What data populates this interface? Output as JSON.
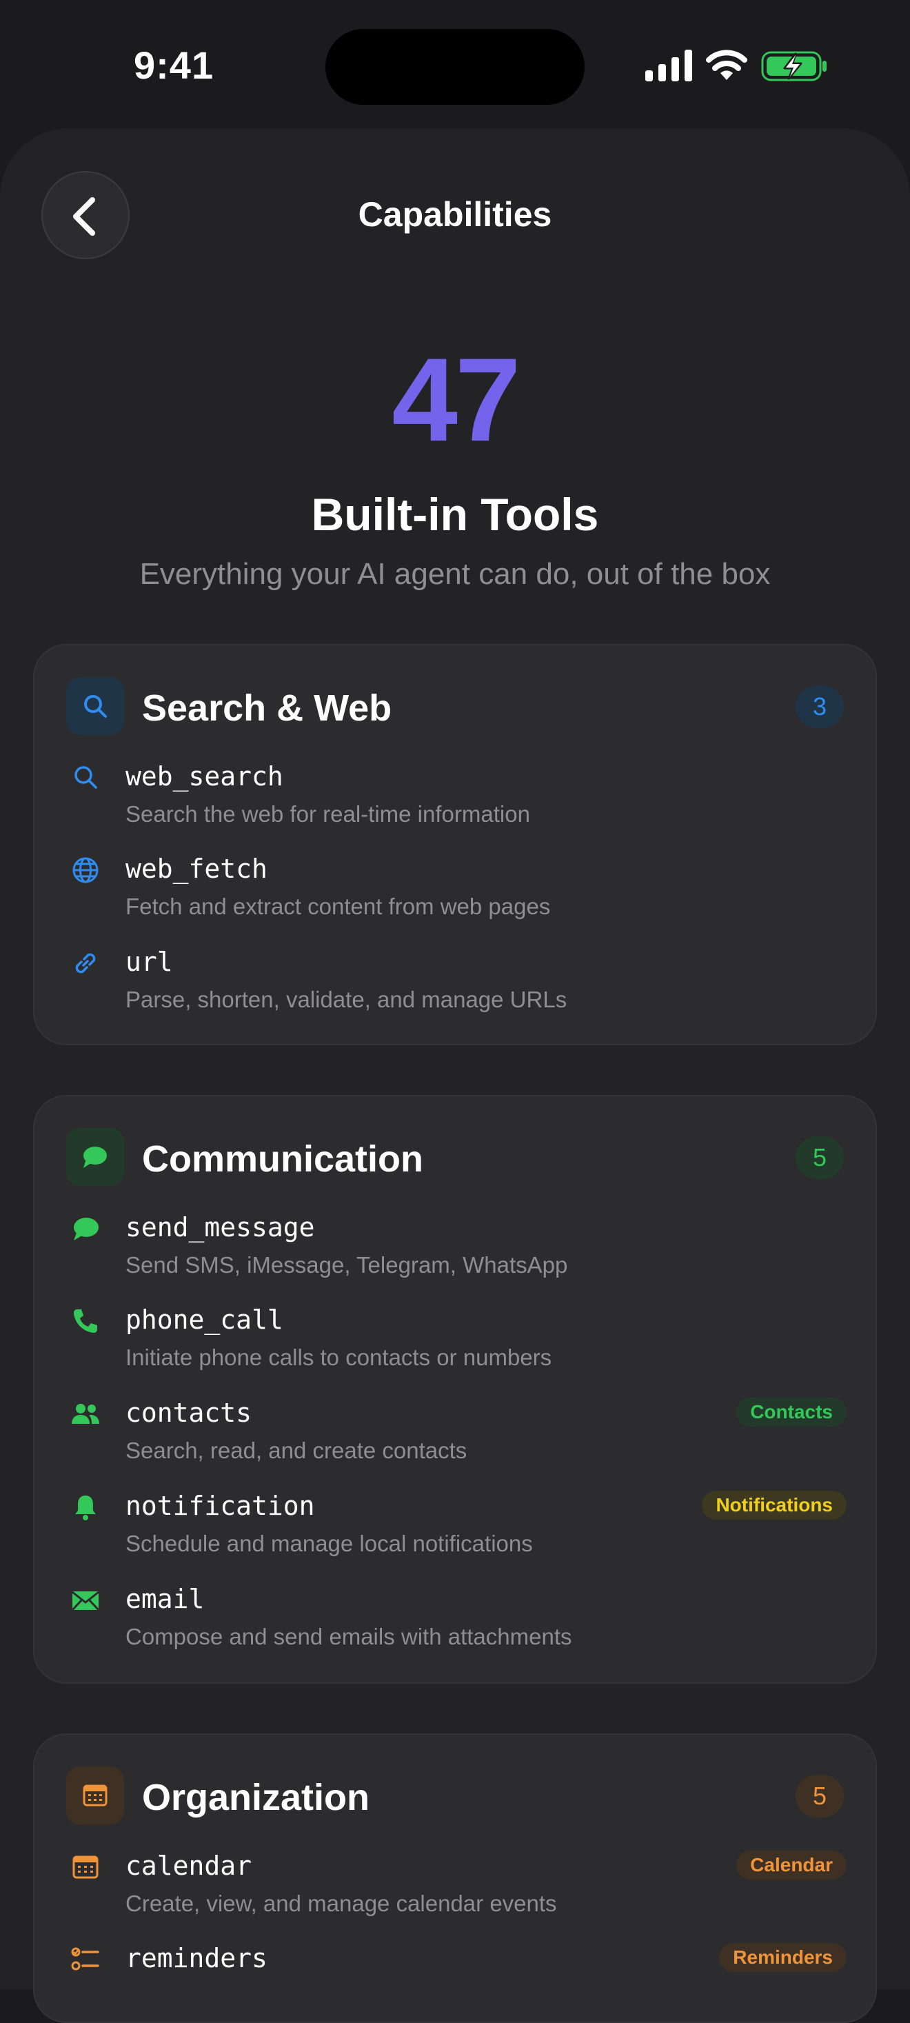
{
  "status": {
    "time": "9:41"
  },
  "header": {
    "title": "Capabilities"
  },
  "hero": {
    "count": "47",
    "title": "Built-in Tools",
    "subtitle": "Everything your AI agent can do, out of the box"
  },
  "colors": {
    "blue": "#2f8cf0",
    "green": "#34c759",
    "orange": "#f0943a",
    "yellow": "#f2cf1d",
    "purple": "#7464ec"
  },
  "sections": [
    {
      "title": "Search & Web",
      "count": "3",
      "icon": "magnifier-icon",
      "tools": [
        {
          "name": "web_search",
          "desc": "Search the web for real-time information",
          "icon": "search-icon"
        },
        {
          "name": "web_fetch",
          "desc": "Fetch and extract content from web pages",
          "icon": "globe-icon"
        },
        {
          "name": "url",
          "desc": "Parse, shorten, validate, and manage URLs",
          "icon": "link-icon"
        }
      ]
    },
    {
      "title": "Communication",
      "count": "5",
      "icon": "chat-bubble-icon",
      "tools": [
        {
          "name": "send_message",
          "desc": "Send SMS, iMessage, Telegram, WhatsApp",
          "icon": "message-icon"
        },
        {
          "name": "phone_call",
          "desc": "Initiate phone calls to contacts or numbers",
          "icon": "phone-icon"
        },
        {
          "name": "contacts",
          "desc": "Search, read, and create contacts",
          "icon": "people-icon",
          "badge": "Contacts"
        },
        {
          "name": "notification",
          "desc": "Schedule and manage local notifications",
          "icon": "bell-icon",
          "badge": "Notifications"
        },
        {
          "name": "email",
          "desc": "Compose and send emails with attachments",
          "icon": "envelope-icon"
        }
      ]
    },
    {
      "title": "Organization",
      "count": "5",
      "icon": "calendar-icon",
      "tools": [
        {
          "name": "calendar",
          "desc": "Create, view, and manage calendar events",
          "icon": "calendar-icon",
          "badge": "Calendar"
        },
        {
          "name": "reminders",
          "desc": "",
          "icon": "checklist-icon",
          "badge": "Reminders"
        }
      ]
    }
  ]
}
